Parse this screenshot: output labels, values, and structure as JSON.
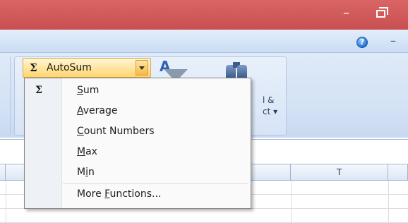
{
  "titlebar": {
    "minimize_label": "–"
  },
  "help": {
    "icon": "help-icon",
    "glyph": "?"
  },
  "ribbon": {
    "autosum": {
      "sigma": "Σ",
      "label": "AutoSum"
    },
    "find_select": {
      "line1": "l &",
      "line2": "ct ▾"
    }
  },
  "columns": {
    "t_label": "T"
  },
  "menu": {
    "gutter_sigma": "Σ",
    "items": [
      {
        "pre": "",
        "ul": "S",
        "post": "um"
      },
      {
        "pre": "",
        "ul": "A",
        "post": "verage"
      },
      {
        "pre": "",
        "ul": "C",
        "post": "ount Numbers"
      },
      {
        "pre": "",
        "ul": "M",
        "post": "ax"
      },
      {
        "pre": "M",
        "ul": "i",
        "post": "n"
      },
      {
        "pre": "More ",
        "ul": "F",
        "post": "unctions..."
      }
    ]
  }
}
